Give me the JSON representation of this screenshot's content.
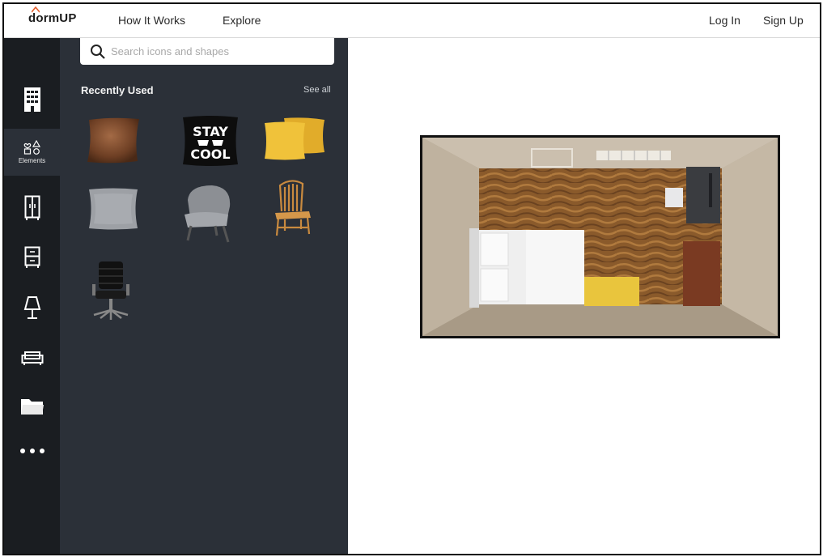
{
  "app": {
    "logo": "dormUP"
  },
  "nav": {
    "how_it_works": "How It Works",
    "explore": "Explore",
    "log_in": "Log In",
    "sign_up": "Sign Up"
  },
  "rail": {
    "items": [
      {
        "name": "templates",
        "icon": "building-icon",
        "label": ""
      },
      {
        "name": "elements",
        "icon": "shapes-icon",
        "label": "Elements",
        "active": true
      },
      {
        "name": "wardrobe",
        "icon": "wardrobe-icon",
        "label": ""
      },
      {
        "name": "dresser",
        "icon": "dresser-icon",
        "label": ""
      },
      {
        "name": "lamp",
        "icon": "lamp-icon",
        "label": ""
      },
      {
        "name": "sofa",
        "icon": "sofa-icon",
        "label": ""
      },
      {
        "name": "folder",
        "icon": "folder-icon",
        "label": ""
      },
      {
        "name": "more",
        "icon": "more-icon",
        "label": ""
      }
    ]
  },
  "panel": {
    "search_placeholder": "Search icons and shapes",
    "section_title": "Recently Used",
    "see_all": "See all",
    "stay_cool_top": "STAY",
    "stay_cool_bottom": "COOL",
    "items": [
      "brown-pillow",
      "stay-cool-pillow",
      "yellow-pillows",
      "gray-pillow",
      "gray-armchair",
      "wooden-chair",
      "office-chair"
    ]
  },
  "colors": {
    "rail_bg": "#1a1d21",
    "panel_bg": "#2b3038",
    "room_wall": "#b8ab98",
    "floor_wood": "#8a5a2b"
  }
}
